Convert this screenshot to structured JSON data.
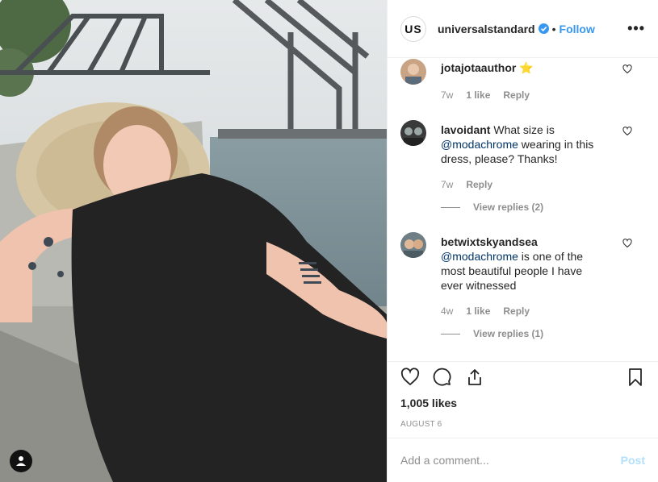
{
  "post": {
    "author": "universalstandard",
    "author_logo_text": "US",
    "follow_label": "Follow",
    "separator": "•",
    "more_label": "•••",
    "likes": "1,005 likes",
    "date": "AUGUST 6"
  },
  "comments": [
    {
      "user": "jotajotaauthor",
      "emoji": "⭐",
      "mention": "",
      "text": "",
      "age": "7w",
      "likes": "1 like",
      "reply": "Reply",
      "view_replies": ""
    },
    {
      "user": "lavoidant",
      "emoji": "",
      "mention": "",
      "text": "What size is ",
      "mention2": "@modachrome",
      "text2": " wearing in this dress, please? Thanks!",
      "age": "7w",
      "likes": "",
      "reply": "Reply",
      "view_replies": "View replies (2)"
    },
    {
      "user": "betwixtskyandsea",
      "emoji": "",
      "mention": "@modachrome",
      "text": " is one of the most beautiful people I have ever witnessed",
      "age": "4w",
      "likes": "1 like",
      "reply": "Reply",
      "view_replies": "View replies (1)"
    }
  ],
  "add_comment": {
    "placeholder": "Add a comment...",
    "post_label": "Post"
  },
  "colors": {
    "link": "#3897f0",
    "mention": "#003569",
    "muted": "#8e8e8e",
    "post_disabled": "#b2dffc"
  },
  "icons": [
    "heart-icon",
    "comment-icon",
    "share-icon",
    "bookmark-icon",
    "verified-badge-icon",
    "user-tag-icon"
  ]
}
